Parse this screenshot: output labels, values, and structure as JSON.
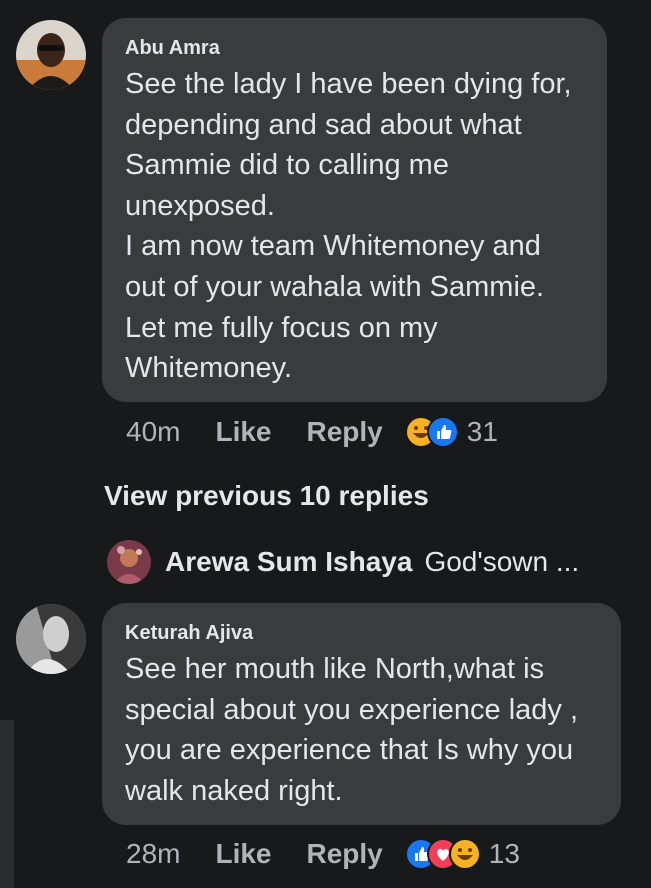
{
  "comments": [
    {
      "author": "Abu Amra",
      "lines": [
        "See the lady I have been dying for,",
        "depending and sad about what",
        "Sammie did to calling me",
        "unexposed.",
        "I am now team Whitemoney and",
        "out of your wahala with Sammie.",
        "Let me fully focus on my",
        "Whitemoney."
      ],
      "time": "40m",
      "like_label": "Like",
      "reply_label": "Reply",
      "reactions": [
        "haha-icon",
        "like-icon"
      ],
      "reaction_count": "31"
    },
    {
      "author": "Keturah Ajiva",
      "lines": [
        "See her mouth like North,what is",
        "special about you experience lady ,",
        "you are experience that Is why you",
        "walk naked right."
      ],
      "time": "28m",
      "like_label": "Like",
      "reply_label": "Reply",
      "reactions": [
        "like-icon",
        "love-icon",
        "haha-icon"
      ],
      "reaction_count": "13"
    }
  ],
  "view_previous": "View previous 10 replies",
  "latest_reply": {
    "author": "Arewa Sum Ishaya",
    "snippet": "God'sown ..."
  },
  "colors": {
    "background": "#18191a",
    "bubble": "#3a3b3c",
    "text": "#e4e6eb",
    "secondary": "#b0b3b8",
    "like_blue": "#1877f2",
    "love_red": "#f33e58",
    "haha_yellow": "#f7b125"
  }
}
